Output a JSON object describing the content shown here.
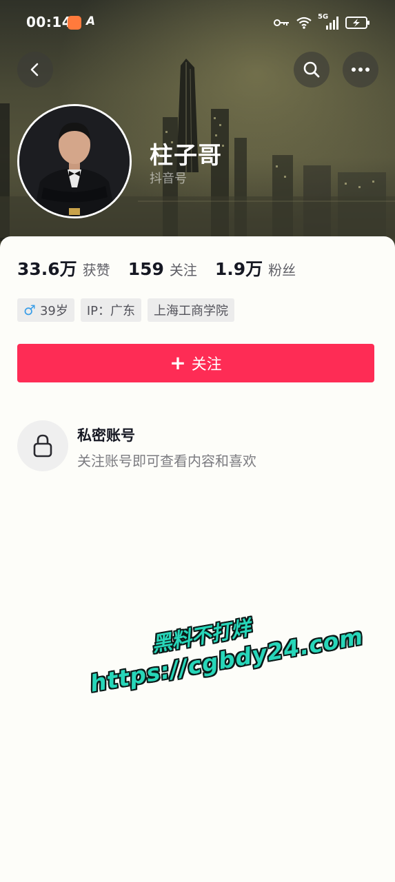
{
  "status_bar": {
    "time": "00:14",
    "network_label": "5G",
    "icons": [
      "shield-app-icon",
      "a-icon",
      "key-icon",
      "wifi-icon",
      "signal-icon",
      "battery-charging-icon"
    ]
  },
  "header": {
    "buttons": [
      "back-icon",
      "search-icon",
      "more-icon"
    ]
  },
  "profile": {
    "name": "柱子哥",
    "id_label": "抖音号"
  },
  "stats": [
    {
      "value": "33.6万",
      "label": "获赞"
    },
    {
      "value": "159",
      "label": "关注"
    },
    {
      "value": "1.9万",
      "label": "粉丝"
    }
  ],
  "tags": {
    "gender_symbol": "♂",
    "age": "39岁",
    "ip": "IP：广东",
    "school": "上海工商学院"
  },
  "follow_button": {
    "icon": "+",
    "label": "关注"
  },
  "private": {
    "title": "私密账号",
    "description": "关注账号即可查看内容和喜欢"
  },
  "watermark": {
    "line1": "黑料不打烊",
    "line2": "https://cgbdy24.com"
  },
  "colors": {
    "accent": "#fe2c55",
    "gender": "#3a9ee8",
    "watermark": "#27d6b9"
  }
}
